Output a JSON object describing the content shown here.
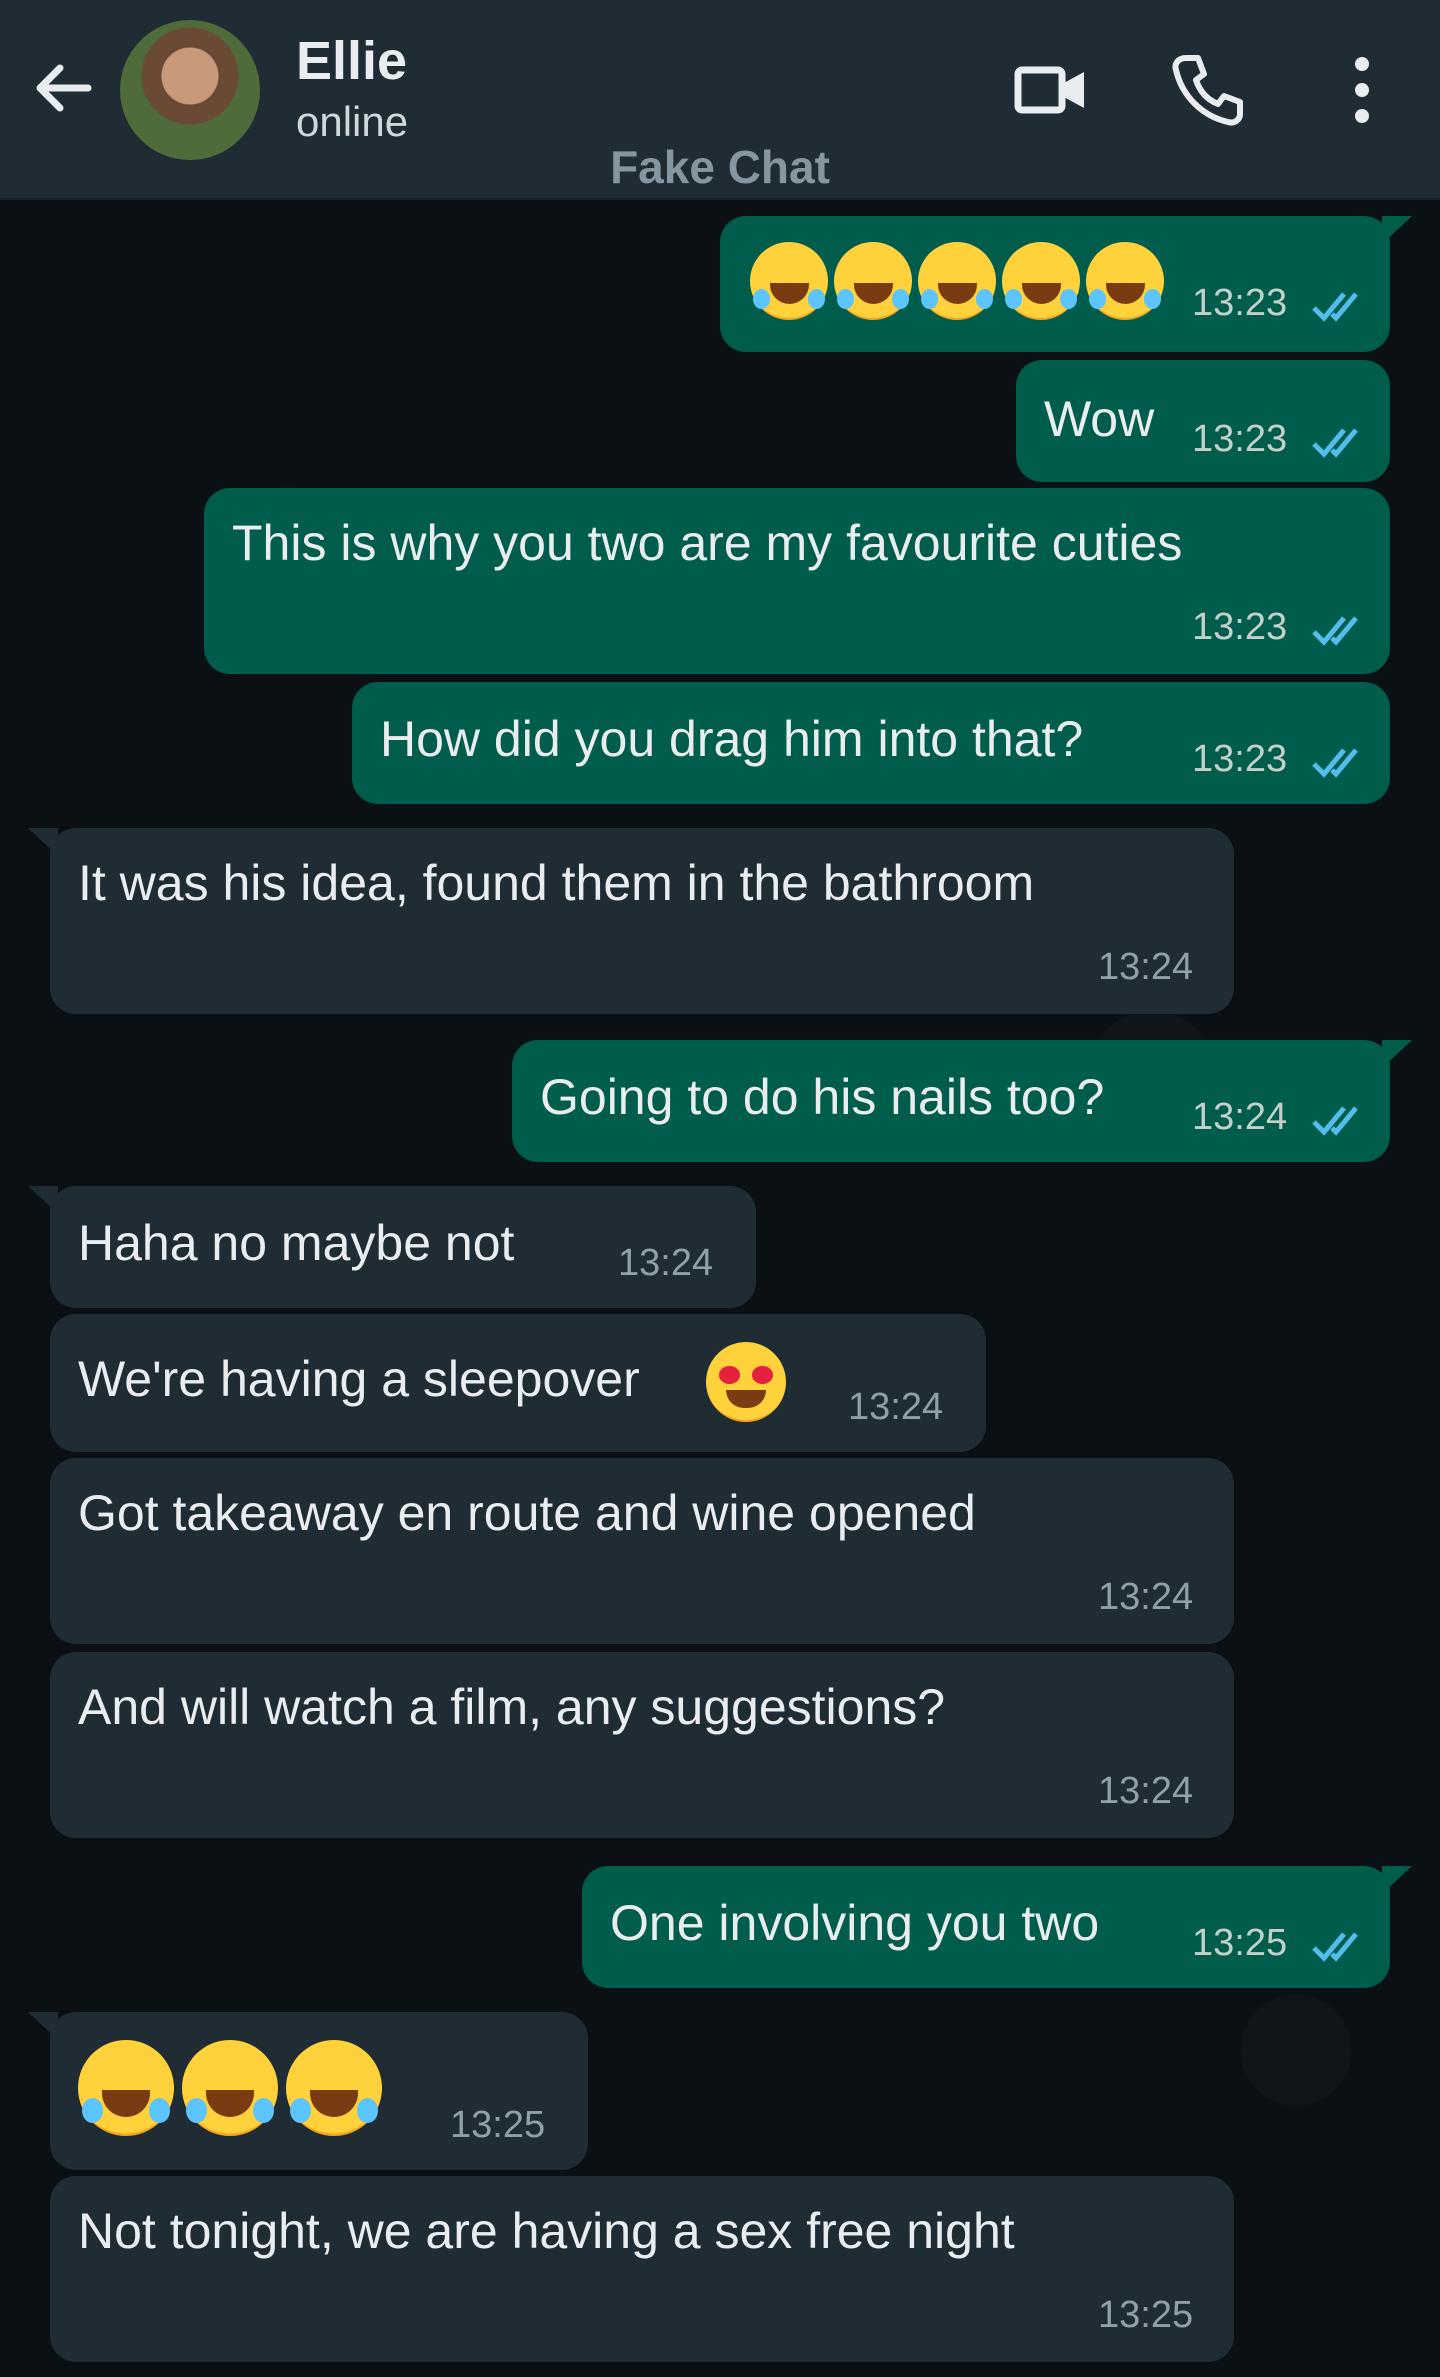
{
  "header": {
    "contact_name": "Ellie",
    "contact_status": "online",
    "title": "Fake Chat",
    "icons": [
      "back-arrow-icon",
      "video-call-icon",
      "phone-call-icon",
      "more-vert-icon"
    ]
  },
  "colors": {
    "header_bg": "#1f2c34",
    "outgoing_bubble": "#005c4b",
    "incoming_bubble": "#1f2c34",
    "read_ticks": "#53bdeb",
    "background": "#0b1014"
  },
  "messages": [
    {
      "dir": "out",
      "text": "",
      "emoji": "rofl",
      "emoji_count": 5,
      "time": "13:23",
      "read": true
    },
    {
      "dir": "out",
      "text": "Wow",
      "time": "13:23",
      "read": true
    },
    {
      "dir": "out",
      "text": "This is why you two are my favourite cuties",
      "time": "13:23",
      "read": true
    },
    {
      "dir": "out",
      "text": "How did you drag him into that?",
      "time": "13:23",
      "read": true
    },
    {
      "dir": "in",
      "text": "It was his idea, found them in the bathroom",
      "time": "13:24"
    },
    {
      "dir": "out",
      "text": "Going to do his nails too?",
      "time": "13:24",
      "read": true
    },
    {
      "dir": "in",
      "text": "Haha no maybe not",
      "time": "13:24"
    },
    {
      "dir": "in",
      "text": "We're having a sleepover",
      "emoji": "heart-eyes",
      "time": "13:24"
    },
    {
      "dir": "in",
      "text": "Got takeaway en route and wine opened",
      "time": "13:24"
    },
    {
      "dir": "in",
      "text": "And will watch a film, any suggestions?",
      "time": "13:24"
    },
    {
      "dir": "out",
      "text": "One involving you two",
      "time": "13:25",
      "read": true
    },
    {
      "dir": "in",
      "text": "",
      "emoji": "rofl",
      "emoji_count": 3,
      "time": "13:25"
    },
    {
      "dir": "in",
      "text": "Not tonight, we are having a sex free night",
      "time": "13:25"
    }
  ]
}
